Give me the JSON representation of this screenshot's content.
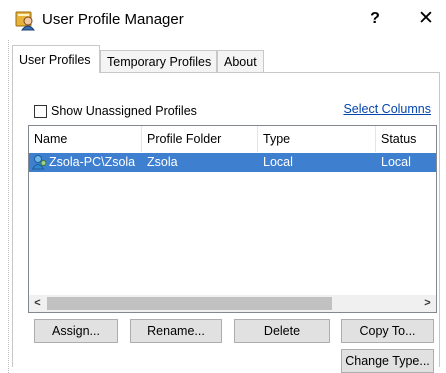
{
  "window": {
    "title": "User Profile Manager",
    "help_label": "?",
    "close_label": "✕"
  },
  "tabs": [
    {
      "label": "User Profiles",
      "active": true
    },
    {
      "label": "Temporary Profiles",
      "active": false
    },
    {
      "label": "About",
      "active": false
    }
  ],
  "options": {
    "show_unassigned_label": "Show Unassigned Profiles",
    "show_unassigned_checked": false,
    "select_columns_label": "Select Columns"
  },
  "list": {
    "columns": [
      "Name",
      "Profile Folder",
      "Type",
      "Status"
    ],
    "rows": [
      {
        "name": "Zsola-PC\\Zsola",
        "profile_folder": "Zsola",
        "type": "Local",
        "status": "Local",
        "selected": true
      }
    ]
  },
  "buttons": {
    "assign": "Assign...",
    "rename": "Rename...",
    "delete": "Delete",
    "copy_to": "Copy To...",
    "change_type": "Change Type..."
  },
  "colors": {
    "selection": "#3f7fd0",
    "link": "#0645ad",
    "button_face": "#e1e1e1"
  },
  "icons": {
    "app": "user-profile-icon",
    "row": "user-icon",
    "scroll_left": "chevron-left-icon",
    "scroll_right": "chevron-right-icon"
  }
}
